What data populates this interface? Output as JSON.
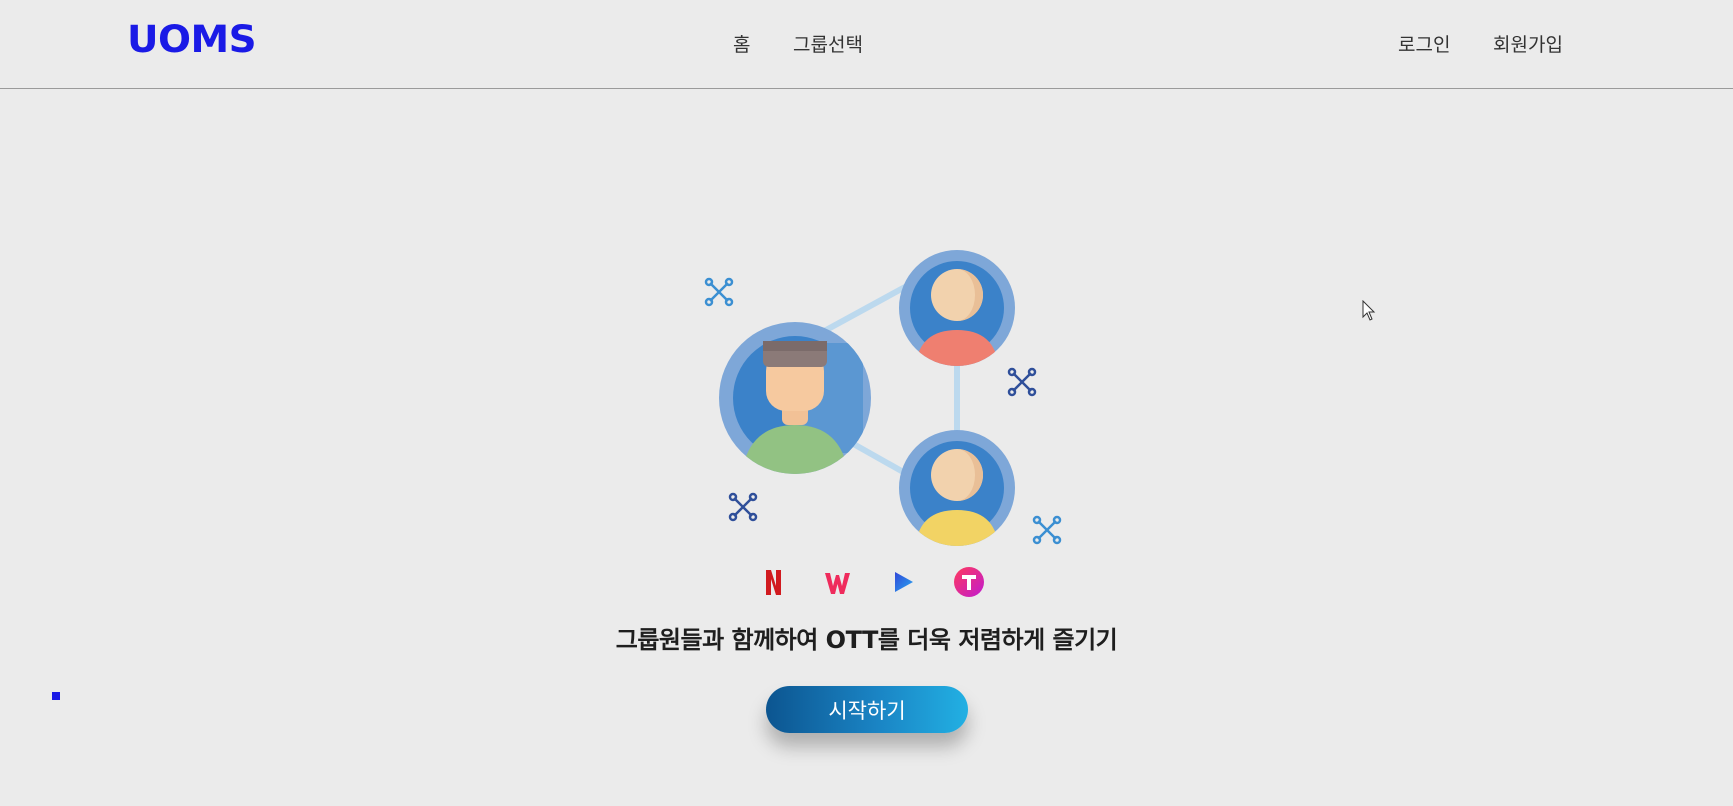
{
  "header": {
    "logo": "UOMS",
    "nav": {
      "home": "홈",
      "group_select": "그룹선택"
    },
    "auth": {
      "login": "로그인",
      "signup": "회원가입"
    }
  },
  "hero": {
    "illustration": "group-network-illustration",
    "ott_icons": [
      "netflix-icon",
      "wavve-icon",
      "play-icon",
      "tving-icon"
    ],
    "tagline": "그룹원들과 함께하여 OTT를 더욱 저렴하게 즐기기",
    "cta_label": "시작하기"
  },
  "colors": {
    "brand": "#1a1ae6",
    "cta_start": "#0c5590",
    "cta_end": "#22b0e3",
    "background": "#ebebeb"
  }
}
